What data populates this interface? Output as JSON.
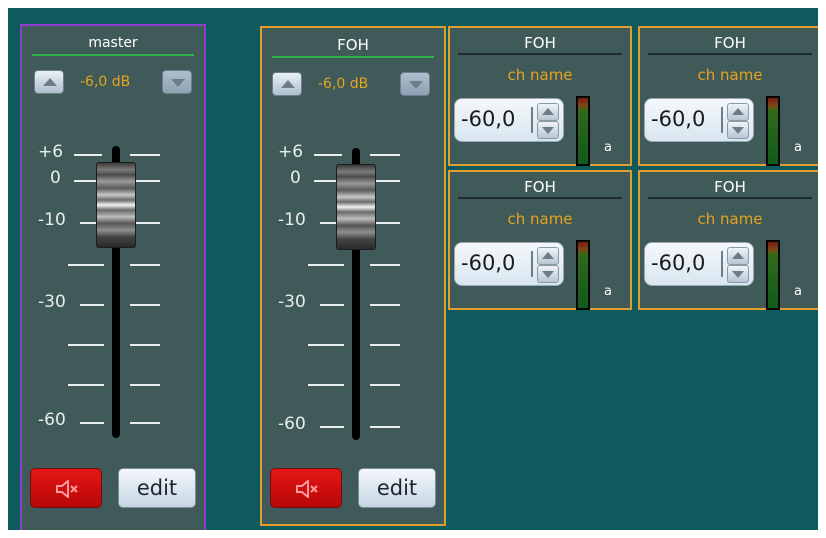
{
  "colors": {
    "background": "#0f5a5c",
    "panel": "#3f5a58",
    "master_border": "#8a3fd0",
    "foh_border": "#e0a030",
    "accent_text": "#e6a31e",
    "title_underline": "#2db34a",
    "mute_red": "#e41616"
  },
  "master": {
    "title": "master",
    "level": "-6,0 dB",
    "fader_level_db": 0,
    "scale": [
      "+6",
      "0",
      "-10",
      "-30",
      "-60"
    ],
    "mute_icon": "speaker-mute-icon",
    "edit_label": "edit"
  },
  "foh_strip": {
    "title": "FOH",
    "level": "-6,0 dB",
    "fader_level_db": 0,
    "scale": [
      "+6",
      "0",
      "-10",
      "-30",
      "-60"
    ],
    "mute_icon": "speaker-mute-icon",
    "edit_label": "edit"
  },
  "sends": [
    {
      "title": "FOH",
      "name": "ch  name",
      "value": "-60,0",
      "meter_letter": "a"
    },
    {
      "title": "FOH",
      "name": "ch  name",
      "value": "-60,0",
      "meter_letter": "a"
    },
    {
      "title": "FOH",
      "name": "ch  name",
      "value": "-60,0",
      "meter_letter": "a"
    },
    {
      "title": "FOH",
      "name": "ch  name",
      "value": "-60,0",
      "meter_letter": "a"
    }
  ]
}
